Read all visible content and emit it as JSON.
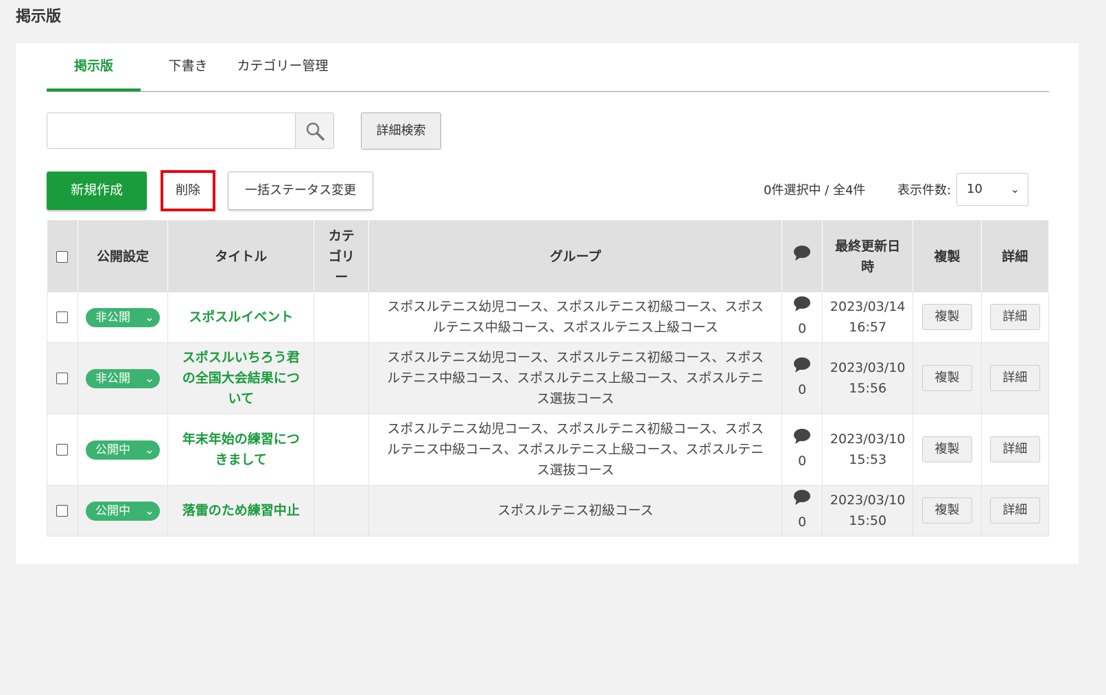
{
  "page": {
    "title": "掲示版"
  },
  "tabs": [
    {
      "label": "掲示版",
      "active": true
    },
    {
      "label": "下書き",
      "active": false
    },
    {
      "label": "カテゴリー管理",
      "active": false
    }
  ],
  "search": {
    "value": "",
    "placeholder": "",
    "advanced_label": "詳細検索"
  },
  "toolbar": {
    "new_label": "新規作成",
    "delete_label": "削除",
    "bulk_status_label": "一括ステータス変更",
    "selection_count": "0件選択中 / 全4件",
    "per_page_label": "表示件数:",
    "per_page_value": "10"
  },
  "table": {
    "headers": {
      "status": "公開設定",
      "title": "タイトル",
      "category": "カテゴリー",
      "group": "グループ",
      "updated": "最終更新日時",
      "copy": "複製",
      "detail": "詳細"
    },
    "rows": [
      {
        "status": "非公開",
        "title": "スポスルイベント",
        "category": "",
        "group": "スポスルテニス幼児コース、スポスルテニス初級コース、スポスルテニス中級コース、スポスルテニス上級コース",
        "comments": "0",
        "updated": "2023/03/14 16:57",
        "copy": "複製",
        "detail": "詳細"
      },
      {
        "status": "非公開",
        "title": "スポスルいちろう君の全国大会結果について",
        "category": "",
        "group": "スポスルテニス幼児コース、スポスルテニス初級コース、スポスルテニス中級コース、スポスルテニス上級コース、スポスルテニス選抜コース",
        "comments": "0",
        "updated": "2023/03/10 15:56",
        "copy": "複製",
        "detail": "詳細"
      },
      {
        "status": "公開中",
        "title": "年末年始の練習につきまして",
        "category": "",
        "group": "スポスルテニス幼児コース、スポスルテニス初級コース、スポスルテニス中級コース、スポスルテニス上級コース、スポスルテニス選抜コース",
        "comments": "0",
        "updated": "2023/03/10 15:53",
        "copy": "複製",
        "detail": "詳細"
      },
      {
        "status": "公開中",
        "title": "落雷のため練習中止",
        "category": "",
        "group": "スポスルテニス初級コース",
        "comments": "0",
        "updated": "2023/03/10 15:50",
        "copy": "複製",
        "detail": "詳細"
      }
    ]
  },
  "colors": {
    "brand_green": "#1a9b3c",
    "pill_green": "#3cb371",
    "highlight_red": "#e60012"
  }
}
